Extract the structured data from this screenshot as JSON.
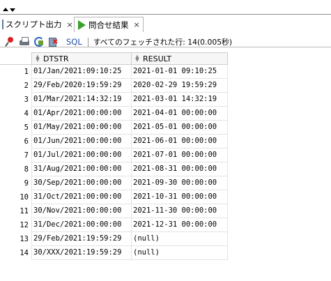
{
  "tabs": {
    "script_output": {
      "label": "スクリプト出力",
      "close": "×"
    },
    "query_result": {
      "label": "問合せ結果",
      "close": "×"
    }
  },
  "toolbar": {
    "sql_label": "SQL",
    "separator": "|",
    "status": "すべてのフェッチされた行: 14(0.005秒)"
  },
  "grid": {
    "columns": [
      "DTSTR",
      "RESULT"
    ],
    "rows": [
      {
        "num": "1",
        "dtstr": "01/Jan/2021:09:10:25",
        "result": "2021-01-01  09:10:25"
      },
      {
        "num": "2",
        "dtstr": "29/Feb/2020:19:59:29",
        "result": "2020-02-29  19:59:29"
      },
      {
        "num": "3",
        "dtstr": "01/Mar/2021:14:32:19",
        "result": "2021-03-01  14:32:19"
      },
      {
        "num": "4",
        "dtstr": "01/Apr/2021:00:00:00",
        "result": "2021-04-01  00:00:00"
      },
      {
        "num": "5",
        "dtstr": "01/May/2021:00:00:00",
        "result": "2021-05-01  00:00:00"
      },
      {
        "num": "6",
        "dtstr": "01/Jun/2021:00:00:00",
        "result": "2021-06-01  00:00:00"
      },
      {
        "num": "7",
        "dtstr": "01/Jul/2021:00:00:00",
        "result": "2021-07-01  00:00:00"
      },
      {
        "num": "8",
        "dtstr": "31/Aug/2021:00:00:00",
        "result": "2021-08-31  00:00:00"
      },
      {
        "num": "9",
        "dtstr": "30/Sep/2021:00:00:00",
        "result": "2021-09-30  00:00:00"
      },
      {
        "num": "10",
        "dtstr": "31/Oct/2021:00:00:00",
        "result": "2021-10-31  00:00:00"
      },
      {
        "num": "11",
        "dtstr": "30/Nov/2021:00:00:00",
        "result": "2021-11-30  00:00:00"
      },
      {
        "num": "12",
        "dtstr": "31/Dec/2021:00:00:00",
        "result": "2021-12-31  00:00:00"
      },
      {
        "num": "13",
        "dtstr": "29/Feb/2021:19:59:29",
        "result": "(null)"
      },
      {
        "num": "14",
        "dtstr": "30/XXX/2021:19:59:29",
        "result": "(null)"
      }
    ]
  }
}
